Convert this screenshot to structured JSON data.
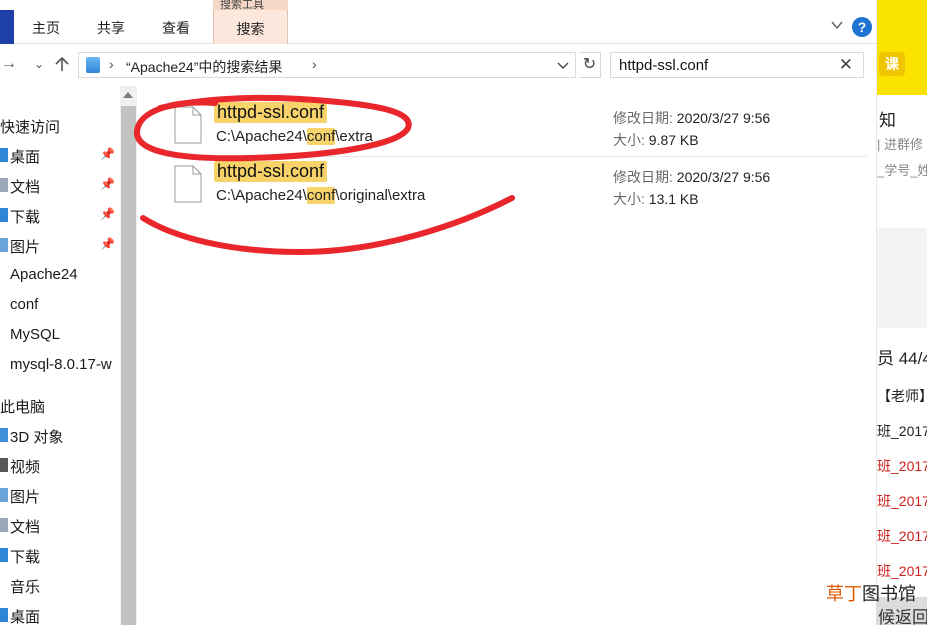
{
  "ribbon": {
    "context_tab_top": "搜索工具",
    "tabs": [
      "主页",
      "共享",
      "查看"
    ],
    "search_tab": "搜索"
  },
  "address": {
    "location": "“Apache24”中的搜索结果",
    "search_query": "httpd-ssl.conf"
  },
  "sidebar": {
    "quick_access": "快速访问",
    "quick_items": [
      "桌面",
      "文档",
      "下载",
      "图片"
    ],
    "folders": [
      "Apache24",
      "conf",
      "MySQL",
      "mysql-8.0.17-w"
    ],
    "this_pc": "此电脑",
    "pc_items": [
      "3D 对象",
      "视频",
      "图片",
      "文档",
      "下载",
      "音乐",
      "桌面"
    ]
  },
  "results": [
    {
      "name": "httpd-ssl.conf",
      "path_prefix": "C:\\Apache24\\",
      "path_highlight": "conf",
      "path_suffix": "\\extra",
      "modified_label": "修改日期:",
      "modified_value": "2020/3/27 9:56",
      "size_label": "大小:",
      "size_value": "9.87 KB"
    },
    {
      "name": "httpd-ssl.conf",
      "path_prefix": "C:\\Apache24\\",
      "path_highlight": "conf",
      "path_suffix": "\\original\\extra",
      "modified_label": "修改日期:",
      "modified_value": "2020/3/27 9:56",
      "size_label": "大小:",
      "size_value": "13.1 KB"
    }
  ],
  "background_window": {
    "badge": "课",
    "lines": [
      "知",
      "| 进群修",
      "_学号_姓",
      "员 44/4",
      "【老师】第",
      "班_2017",
      "班_2017",
      "班_2017",
      "班_2017",
      "班_2017",
      "候返回"
    ]
  },
  "watermark": {
    "orange": "草丁",
    "dark": "图书馆"
  },
  "colors": {
    "highlight": "#f7d36a",
    "annotation": "#e8262b",
    "search_tab": "#fbe7dc",
    "help": "#1e73d0"
  }
}
